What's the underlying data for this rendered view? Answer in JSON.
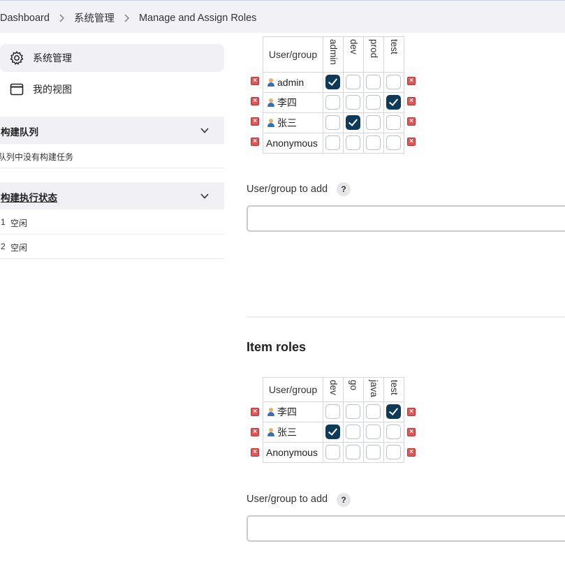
{
  "breadcrumb": [
    "Dashboard",
    "系统管理",
    "Manage and Assign Roles"
  ],
  "sidebar": {
    "tasks": [
      {
        "label": "系统管理",
        "icon": "gear-icon",
        "active": true
      },
      {
        "label": "我的视图",
        "icon": "window-icon",
        "active": false
      }
    ],
    "build_queue": {
      "title": "构建队列",
      "empty_text": "队列中没有构建任务"
    },
    "executors": {
      "title": "构建执行状态",
      "rows": [
        {
          "num": "1",
          "status": "空闲"
        },
        {
          "num": "2",
          "status": "空闲"
        }
      ]
    }
  },
  "global_roles": {
    "header": "User/group",
    "roles": [
      "admin",
      "dev",
      "prod",
      "test"
    ],
    "rows": [
      {
        "name": "admin",
        "user_icon": true,
        "checks": [
          true,
          false,
          false,
          false
        ]
      },
      {
        "name": "李四",
        "user_icon": true,
        "checks": [
          false,
          false,
          false,
          true
        ]
      },
      {
        "name": "张三",
        "user_icon": true,
        "checks": [
          false,
          true,
          false,
          false
        ]
      },
      {
        "name": "Anonymous",
        "user_icon": false,
        "checks": [
          false,
          false,
          false,
          false
        ]
      }
    ],
    "add_label": "User/group to add",
    "add_value": ""
  },
  "item_roles": {
    "title": "Item roles",
    "header": "User/group",
    "roles": [
      "dev",
      "go",
      "java",
      "test"
    ],
    "rows": [
      {
        "name": "李四",
        "user_icon": true,
        "checks": [
          false,
          false,
          false,
          true
        ]
      },
      {
        "name": "张三",
        "user_icon": true,
        "checks": [
          true,
          false,
          false,
          false
        ]
      },
      {
        "name": "Anonymous",
        "user_icon": false,
        "checks": [
          false,
          false,
          false,
          false
        ]
      }
    ],
    "add_label": "User/group to add",
    "add_value": ""
  },
  "help_symbol": "?",
  "delete_icon": "delete-icon",
  "colors": {
    "checked": "#0e3a5a",
    "delete": "#e35454",
    "panel": "#f0f0f5"
  }
}
